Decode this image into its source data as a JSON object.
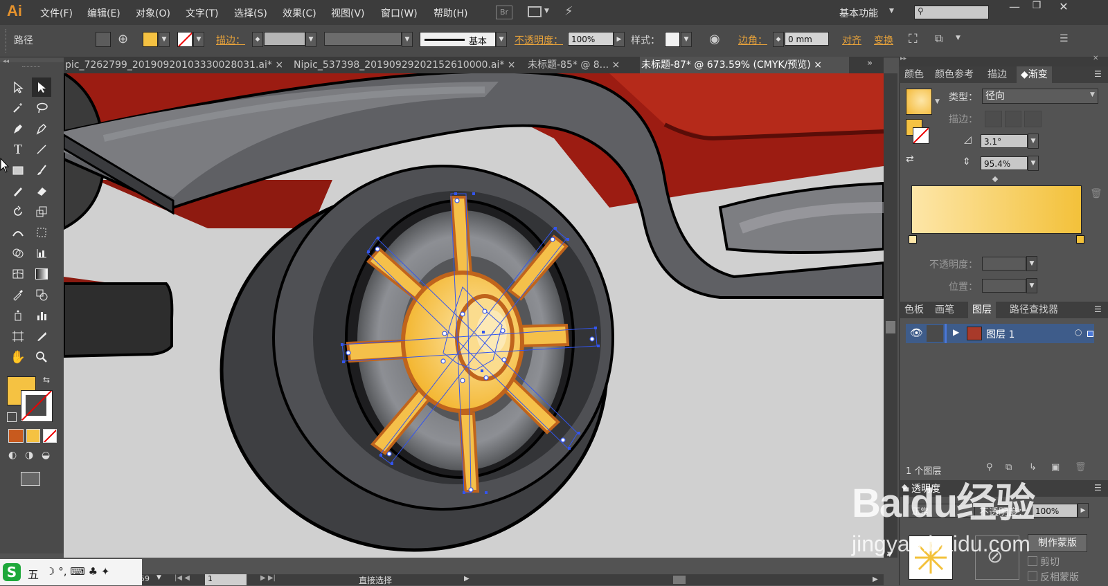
{
  "app": {
    "logo": "Ai",
    "workspace": "基本功能",
    "search_placeholder": ""
  },
  "menu": [
    "文件(F)",
    "编辑(E)",
    "对象(O)",
    "文字(T)",
    "选择(S)",
    "效果(C)",
    "视图(V)",
    "窗口(W)",
    "帮助(H)"
  ],
  "menu_extra": {
    "bridge": "Br"
  },
  "control": {
    "selection_type": "路径",
    "stroke_label": "描边：",
    "brush_label": "基本",
    "opacity_label": "不透明度：",
    "opacity_value": "100%",
    "style_label": "样式：",
    "corner_label": "边角：",
    "corner_value": "0 mm",
    "align_label": "对齐",
    "transform_label": "变换"
  },
  "tabs": [
    {
      "label": "pic_7262799_20190920103330028031.ai*",
      "close": "×"
    },
    {
      "label": "Nipic_537398_20190929202152610000.ai*",
      "close": "×"
    },
    {
      "label": "未标题-85* @ 8...",
      "close": "×"
    },
    {
      "label": "未标题-87* @ 673.59% (CMYK/预览)",
      "close": "×",
      "active": true
    }
  ],
  "gradient_panel": {
    "tabs": [
      "颜色",
      "颜色参考",
      "描边",
      "渐变"
    ],
    "type_label": "类型：",
    "type_value": "径向",
    "stroke_label": "描边：",
    "angle_value": "3.1°",
    "aspect_value": "95.4%",
    "opacity_label": "不透明度：",
    "location_label": "位置：",
    "stops": [
      "#fde6a8",
      "#f3c13a"
    ]
  },
  "layers_panel": {
    "tabs": [
      "色板",
      "画笔",
      "图层",
      "路径查找器"
    ],
    "layer_name": "图层 1",
    "count": "1 个图层"
  },
  "transparency_panel": {
    "title": "透明度",
    "mode": "正常",
    "opacity_label": "不透明度：",
    "opacity_value": "100%",
    "make_mask": "制作蒙版",
    "clip": "剪切",
    "invert": "反相蒙版"
  },
  "status": {
    "zoom": "59",
    "page": "1",
    "tool": "直接选择"
  },
  "watermark": {
    "line1": "Baidu经验",
    "line2": "jingyan.baidu.com"
  },
  "ime": {
    "mode": "五",
    "icons": "☽ °, ⌨ ♣ ✦"
  },
  "colors": {
    "fill": "#f5c242",
    "accent": "#e7a23b",
    "selection": "#3355ee"
  }
}
